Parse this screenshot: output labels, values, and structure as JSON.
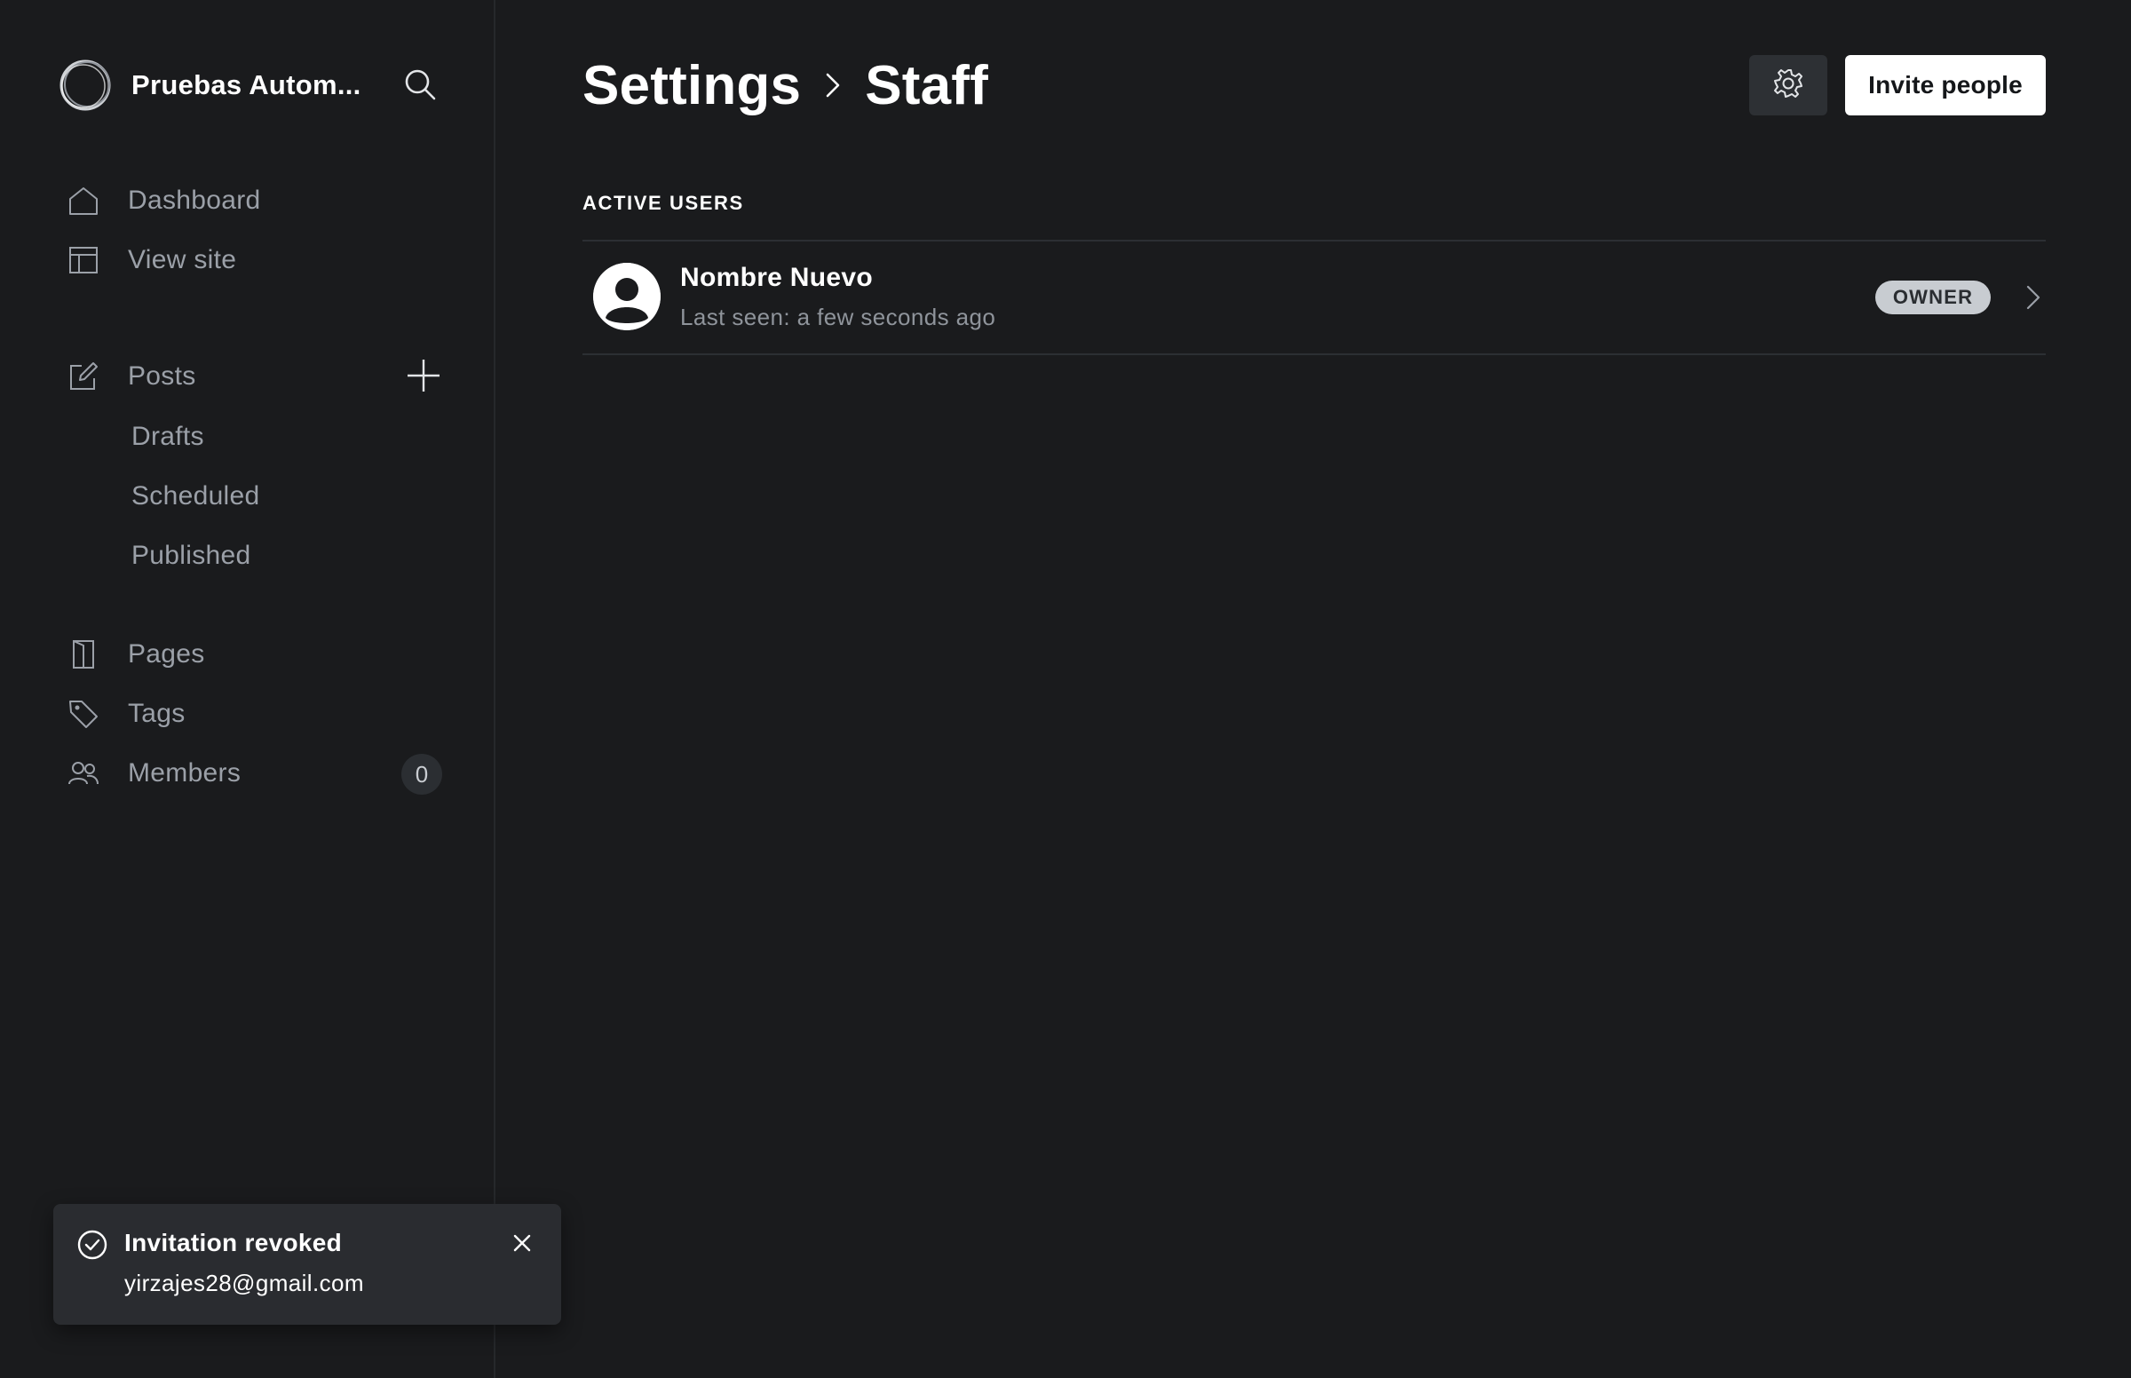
{
  "sidebar": {
    "site_name": "Pruebas Autom...",
    "nav": {
      "dashboard": "Dashboard",
      "view_site": "View site",
      "posts": "Posts",
      "drafts": "Drafts",
      "scheduled": "Scheduled",
      "published": "Published",
      "pages": "Pages",
      "tags": "Tags",
      "members": "Members",
      "members_count": "0"
    },
    "icons": {
      "brand": "brand-ring-icon",
      "search": "search-icon",
      "dashboard": "home-icon",
      "view_site": "layout-icon",
      "posts": "edit-icon",
      "add_post": "plus-icon",
      "pages": "page-icon",
      "tags": "tag-icon",
      "members": "members-icon"
    }
  },
  "header": {
    "breadcrumb": [
      "Settings",
      "Staff"
    ],
    "invite_label": "Invite people",
    "icons": {
      "settings": "gear-icon",
      "separator": "chevron-right-icon"
    }
  },
  "staff": {
    "section_title": "ACTIVE USERS",
    "users": [
      {
        "name": "Nombre Nuevo",
        "last_seen": "Last seen: a few seconds ago",
        "role": "OWNER"
      }
    ]
  },
  "toast": {
    "title": "Invitation revoked",
    "message": "yirzajes28@gmail.com",
    "icons": {
      "status": "check-circle-icon",
      "close": "close-icon"
    }
  },
  "colors": {
    "background": "#1a1b1d",
    "sidebar_text": "#9ba0a8",
    "primary_button": "#ffffff",
    "badge": "#c8ccd1",
    "toast_bg": "#2a2c30"
  }
}
